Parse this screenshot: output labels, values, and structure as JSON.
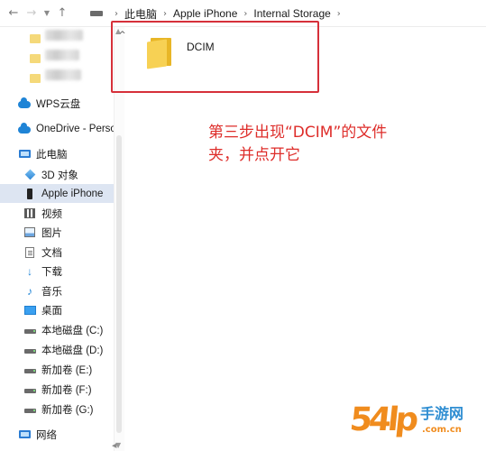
{
  "address_bar": {
    "breadcrumbs": [
      "此电脑",
      "Apple iPhone",
      "Internal Storage"
    ]
  },
  "sidebar": {
    "items": [
      {
        "label": "WPS云盘",
        "icon": "cloud-folder-icon"
      },
      {
        "label": "OneDrive - Perso",
        "icon": "onedrive-cloud-icon"
      },
      {
        "label": "此电脑",
        "icon": "computer-icon"
      },
      {
        "label": "3D 对象",
        "icon": "3d-objects-icon"
      },
      {
        "label": "Apple iPhone",
        "icon": "iphone-icon",
        "selected": true
      },
      {
        "label": "视频",
        "icon": "video-icon"
      },
      {
        "label": "图片",
        "icon": "pictures-icon"
      },
      {
        "label": "文档",
        "icon": "documents-icon"
      },
      {
        "label": "下载",
        "icon": "download-arrow-icon"
      },
      {
        "label": "音乐",
        "icon": "music-note-icon"
      },
      {
        "label": "桌面",
        "icon": "desktop-icon"
      },
      {
        "label": "本地磁盘 (C:)",
        "icon": "drive-icon"
      },
      {
        "label": "本地磁盘 (D:)",
        "icon": "drive-icon"
      },
      {
        "label": "新加卷 (E:)",
        "icon": "drive-icon"
      },
      {
        "label": "新加卷 (F:)",
        "icon": "drive-icon"
      },
      {
        "label": "新加卷 (G:)",
        "icon": "drive-icon"
      },
      {
        "label": "网络",
        "icon": "network-icon"
      }
    ]
  },
  "main": {
    "folders": [
      {
        "name": "DCIM"
      }
    ]
  },
  "annotation": {
    "line1": "第三步出现“DCIM”的文件",
    "line2": "夹，并点开它"
  },
  "watermark": {
    "number": "54",
    "glyph": "lp",
    "text": "手游网",
    "url": ".com.cn"
  }
}
